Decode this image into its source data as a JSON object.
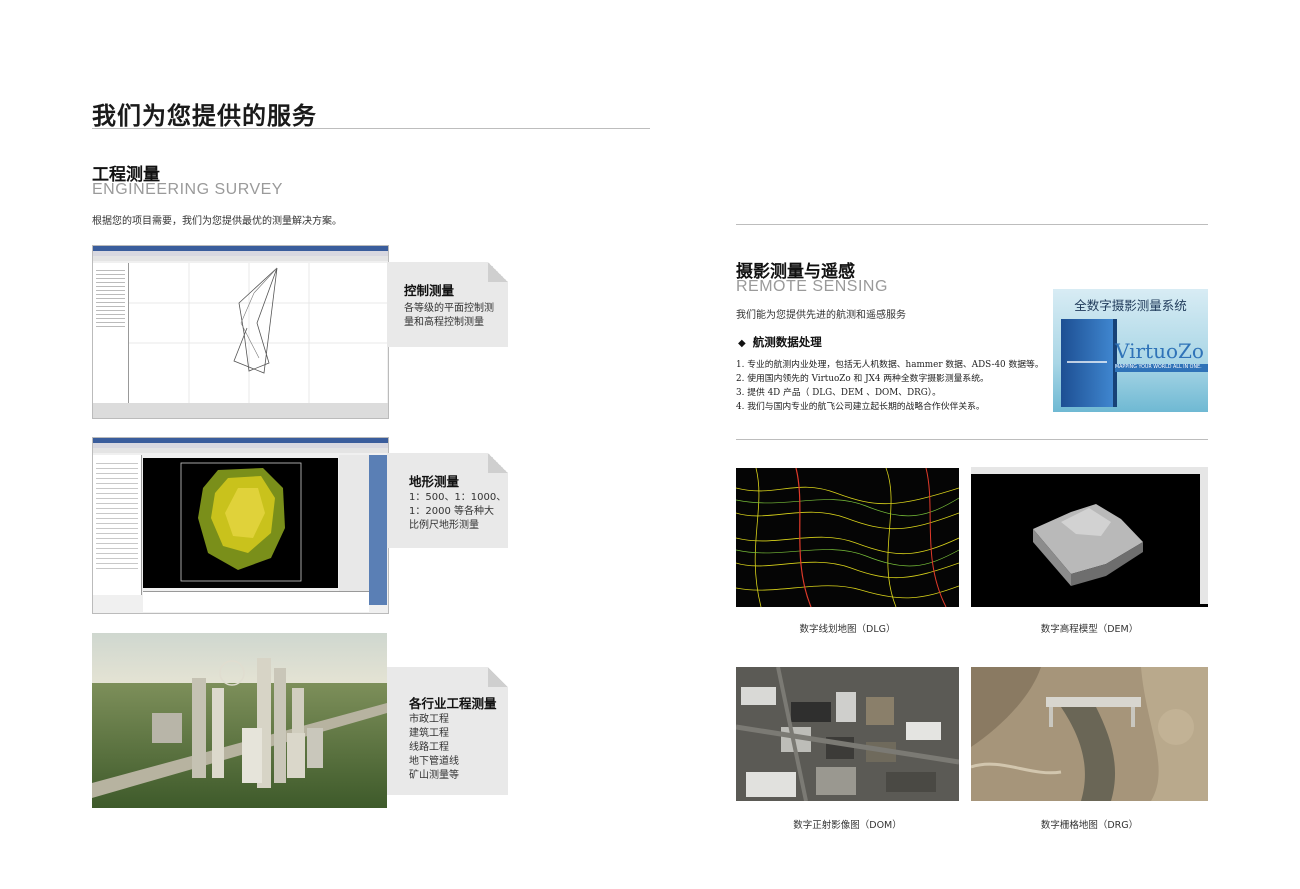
{
  "page_title": "我们为您提供的服务",
  "engineering": {
    "title_cn": "工程测量",
    "title_en": "ENGINEERING SURVEY",
    "intro": "根据您的项目需要，我们为您提供最优的测量解决方案。",
    "cards": [
      {
        "title": "控制测量",
        "lines": [
          "各等级的平面控制测",
          "量和高程控制测量"
        ]
      },
      {
        "title": "地形测量",
        "lines": [
          "1：500、1：1000、",
          "1：2000 等各种大",
          "比例尺地形测量"
        ]
      },
      {
        "title": "各行业工程测量",
        "lines": [
          "市政工程",
          "建筑工程",
          "线路工程",
          "地下管道线",
          "矿山测量等"
        ]
      }
    ]
  },
  "remote": {
    "title_cn": "摄影测量与遥感",
    "title_en": "REMOTE SENSING",
    "intro": "我们能为您提供先进的航测和遥感服务",
    "subhead": "航测数据处理",
    "items": [
      "1. 专业的航测内业处理，包括无人机数据、hammer 数据、ADS-40 数据等。",
      "2. 使用国内领先的 VirtuoZo 和 JX4 两种全数字摄影测量系统。",
      "3. 提供 4D 产品（ DLG、DEM 、DOM、DRG）。",
      "4. 我们与国内专业的航飞公司建立起长期的战略合作伙伴关系。"
    ],
    "product": {
      "banner": "全数字摄影测量系统",
      "logo": "VirtuoZo",
      "tagline": "MAPPING YOUR WORLD ALL IN ONE."
    },
    "captions": [
      "数字线划地图（DLG）",
      "数字高程模型（DEM）",
      "数字正射影像图（DOM）",
      "数字栅格地图（DRG）"
    ]
  },
  "colors": {
    "card_bg": "#e9e9e9",
    "accent_green": "#8bbf3a",
    "product_blue": "#2f73b8"
  }
}
